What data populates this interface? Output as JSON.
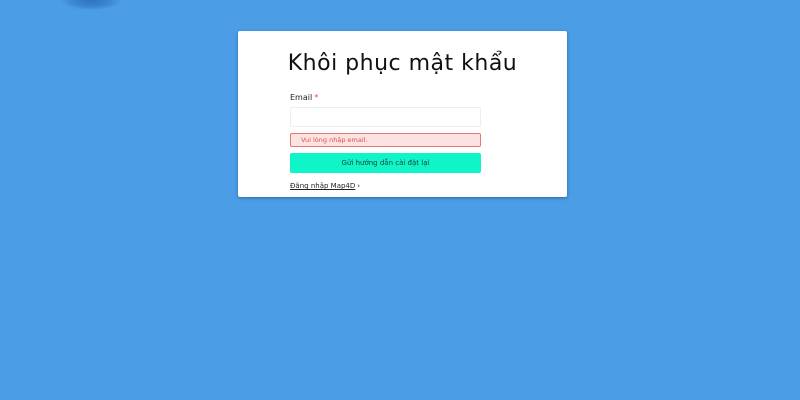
{
  "page": {
    "background_color": "#4b9de6"
  },
  "card": {
    "title": "Khôi phục mật khẩu",
    "email_label": "Email",
    "required_mark": "*",
    "email_value": "",
    "email_placeholder": "",
    "error_message": "Vui lòng nhập email.",
    "submit_label": "Gửi hướng dẫn cài đặt lại",
    "submit_color": "#10f5c8",
    "login_link_label": "Đăng nhập Map4D",
    "login_link_icon": "chevron-right-icon"
  }
}
